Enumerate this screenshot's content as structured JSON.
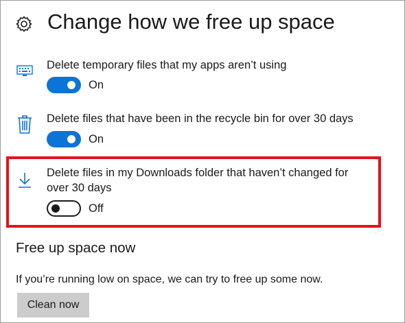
{
  "header": {
    "title": "Change how we free up space",
    "icon": "gear-icon"
  },
  "settings": [
    {
      "icon": "keyboard-icon",
      "label": "Delete temporary files that my apps aren’t using",
      "toggle": {
        "state": "on",
        "state_label": "On"
      }
    },
    {
      "icon": "trash-icon",
      "label": "Delete files that have been in the recycle bin for over 30 days",
      "toggle": {
        "state": "on",
        "state_label": "On"
      }
    },
    {
      "icon": "download-icon",
      "label": "Delete files in my Downloads folder that haven’t changed for over 30 days",
      "toggle": {
        "state": "off",
        "state_label": "Off"
      },
      "highlighted": true
    }
  ],
  "free_up_now": {
    "title": "Free up space now",
    "description": "If you’re running low on space, we can try to free up some now.",
    "button_label": "Clean now"
  },
  "colors": {
    "toggle_on": "#0a74d8",
    "icon_blue": "#0a74d8",
    "highlight_border": "#e3121b",
    "button_bg": "#cccccc"
  }
}
